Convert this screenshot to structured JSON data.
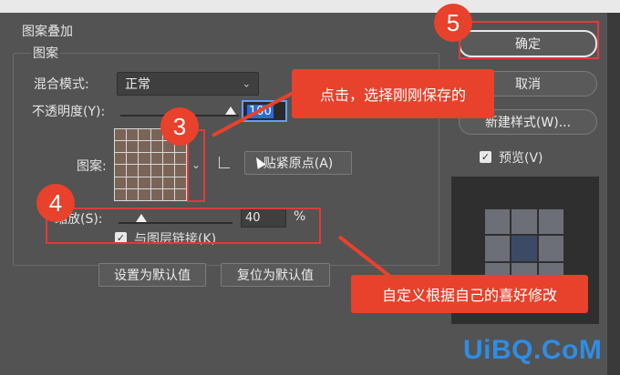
{
  "dialog": {
    "section_title": "图案叠加",
    "group_title": "图案",
    "blend_mode": {
      "label": "混合模式:",
      "value": "正常"
    },
    "opacity": {
      "label": "不透明度(Y):",
      "value": "100"
    },
    "pattern": {
      "label": "图案:",
      "snap_origin_button": "贴紧原点(A)"
    },
    "scale": {
      "label": "缩放(S):",
      "value": "40",
      "unit": "%"
    },
    "link_with_layer": {
      "label": "与图层链接(K)",
      "checked": true
    },
    "set_default_button": "设置为默认值",
    "reset_default_button": "复位为默认值"
  },
  "side_panel": {
    "ok_button": "确定",
    "cancel_button": "取消",
    "new_style_button": "新建样式(W)...",
    "preview": {
      "label": "预览(V)",
      "checked": true
    }
  },
  "annotations": {
    "badge_3": "3",
    "badge_4": "4",
    "badge_5": "5",
    "callout_pattern": "点击，选择刚刚保存的",
    "callout_scale": "自定义根据自己的喜好修改"
  },
  "watermark": "UiBQ.CoM",
  "colors": {
    "annotation_red": "#e8412c",
    "dialog_bg": "#535353",
    "highlight_blue": "#2c6bd6",
    "watermark_blue": "#2f8de4"
  },
  "icons": [
    "chevron-down-icon",
    "reset-origin-icon",
    "checkmark-icon",
    "slider-thumb-icon",
    "arrow-icon"
  ]
}
